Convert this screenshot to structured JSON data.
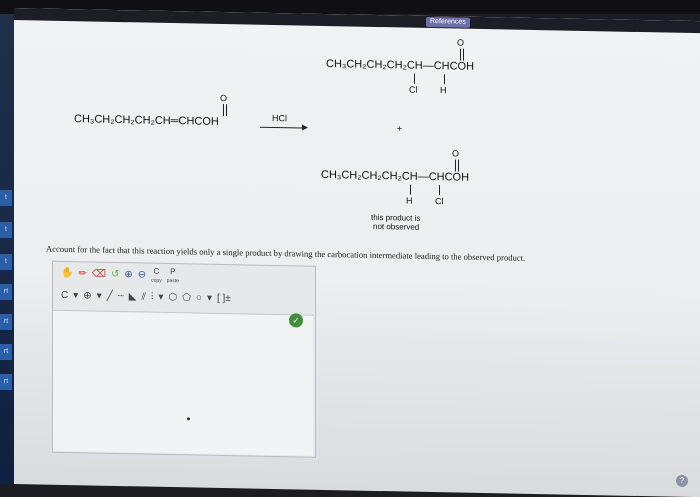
{
  "references": {
    "label": "References"
  },
  "reactant": {
    "chain": "CH₃CH₂CH₂CH₂CH═CHCOH",
    "carbonyl_o": "O"
  },
  "reagent": {
    "label": "HCl"
  },
  "plus": "+",
  "product1": {
    "chain": "CH₃CH₂CH₂CH₂CH—CHCOH",
    "carbonyl_o": "O",
    "sub_left": "Cl",
    "sub_right": "H"
  },
  "product2": {
    "chain": "CH₃CH₂CH₂CH₂CH—CHCOH",
    "carbonyl_o": "O",
    "sub_left": "H",
    "sub_right": "Cl",
    "note_line1": "this product is",
    "note_line2": "not observed"
  },
  "question": "Account for the fact that this reaction yields only a single product by drawing the carbocation intermediate leading to the observed product.",
  "editor": {
    "toolbar1": {
      "hand": "✋",
      "pencil": "✏",
      "eraser": "⌫",
      "lasso": "↺",
      "zoom_in": "⊕",
      "zoom_out": "⊖",
      "copy": "C",
      "copy_sub": "copy",
      "paste": "P",
      "paste_sub": "paste"
    },
    "toolbar2": {
      "carbon": "C",
      "caret1": "▾",
      "charge_plus": "⊕",
      "caret2": "▾",
      "single_bond": "╱",
      "dotted_bond": "┈",
      "wedge_bond": "◣",
      "double_bond": "⫽",
      "triple_bond": "⫶",
      "caret3": "▾",
      "ring_hex": "⬡",
      "ring_pent": "⬠",
      "ring_circle": "○",
      "caret4": "▾",
      "bracket": "[ ]±"
    },
    "status": "✓"
  },
  "side_tabs": [
    "r",
    "r",
    "r",
    "t",
    "t",
    "t",
    "rt",
    "rt",
    "rt",
    "rt"
  ],
  "help": "?"
}
